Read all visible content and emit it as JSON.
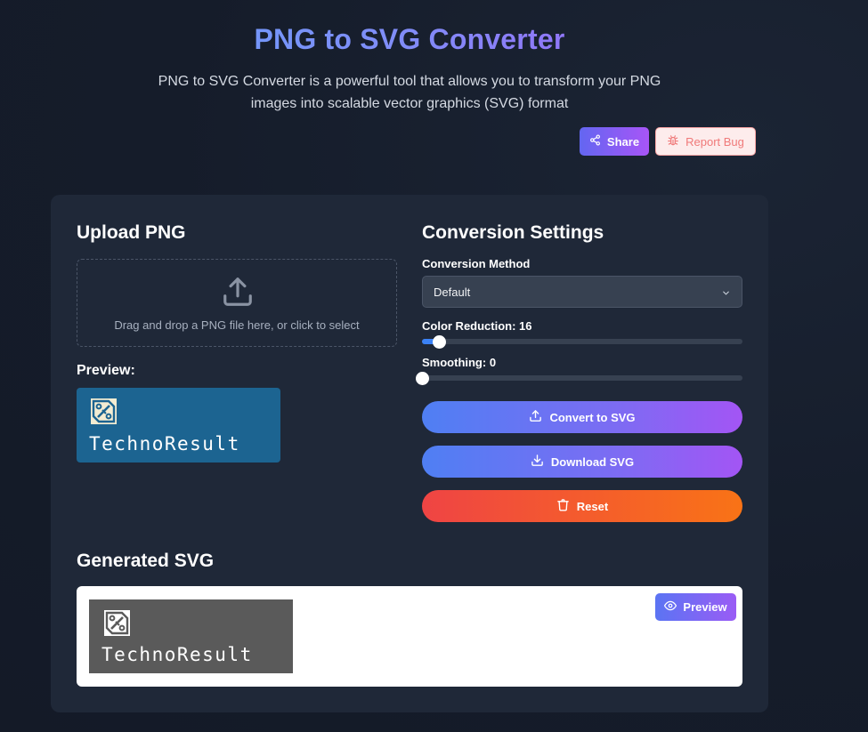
{
  "header": {
    "title": "PNG to SVG Converter",
    "subtitle": "PNG to SVG Converter is a powerful tool that allows you to transform your PNG images into scalable vector graphics (SVG) format",
    "share_label": "Share",
    "share_icon": "share-icon",
    "report_label": "Report Bug",
    "report_icon": "bug-icon"
  },
  "upload": {
    "heading": "Upload PNG",
    "dropzone_text": "Drag and drop a PNG file here, or click to select",
    "dropzone_icon": "upload-icon",
    "preview_label": "Preview:",
    "preview_logo_text": "TechnoResult"
  },
  "settings": {
    "heading": "Conversion Settings",
    "method_label": "Conversion Method",
    "method_value": "Default",
    "color_reduction_label": "Color Reduction: 16",
    "color_reduction_fraction": 0.055,
    "smoothing_label": "Smoothing: 0",
    "smoothing_fraction": 0,
    "convert_label": "Convert to SVG",
    "download_label": "Download SVG",
    "reset_label": "Reset"
  },
  "generated": {
    "heading": "Generated SVG",
    "preview_button": "Preview",
    "logo_text": "TechnoResult"
  },
  "colors": {
    "accent_blue": "#3b82f6",
    "accent_purple": "#a855f7",
    "danger": "#ef4444",
    "card_bg": "#1f2838",
    "page_bg": "#151c2a"
  }
}
